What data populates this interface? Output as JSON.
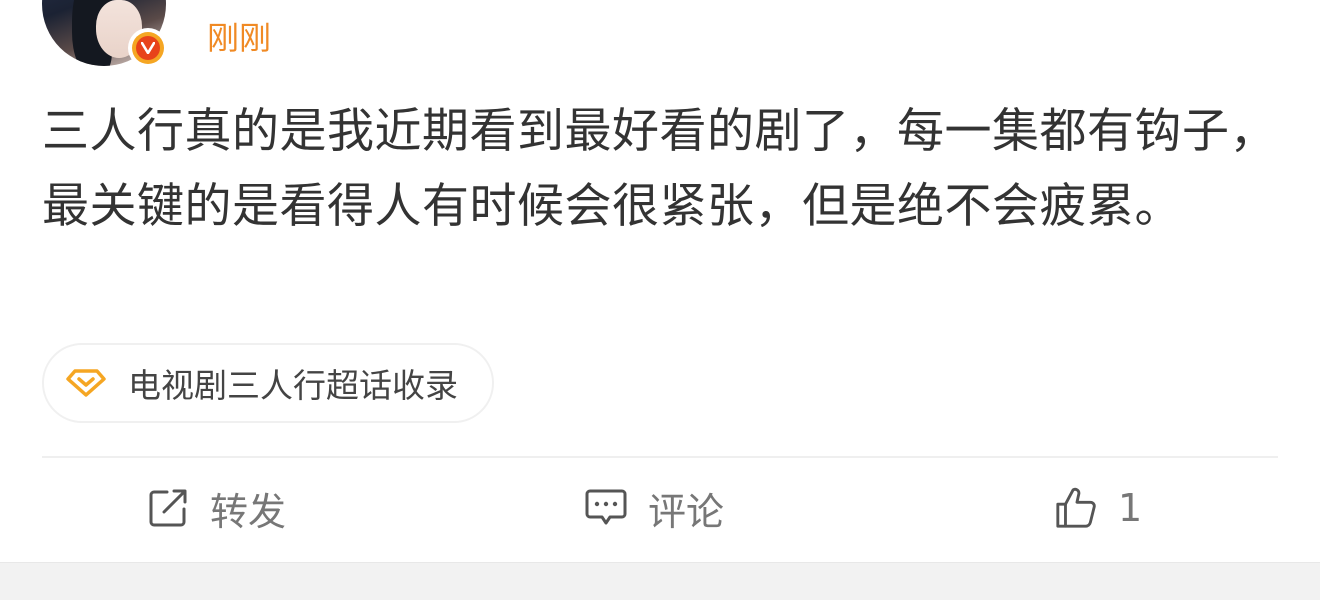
{
  "post": {
    "timestamp": "刚刚",
    "text": "三人行真的是我近期看到最好看的剧了，每一集都有钩子，最关键的是看得人有时候会很紧张，但是绝不会疲累。"
  },
  "topic": {
    "label": "电视剧三人行超话收录"
  },
  "actions": {
    "repost_label": "转发",
    "comment_label": "评论",
    "like_count": "1"
  },
  "icons": {
    "avatar": "user-avatar",
    "verified": "verified-v-icon",
    "topic": "diamond-icon",
    "repost": "share-edit-icon",
    "comment": "comment-bubble-icon",
    "like": "thumbs-up-icon"
  },
  "colors": {
    "timestamp": "#f08a24",
    "verified_badge": "#e8431a",
    "topic_icon": "#f5a623"
  }
}
